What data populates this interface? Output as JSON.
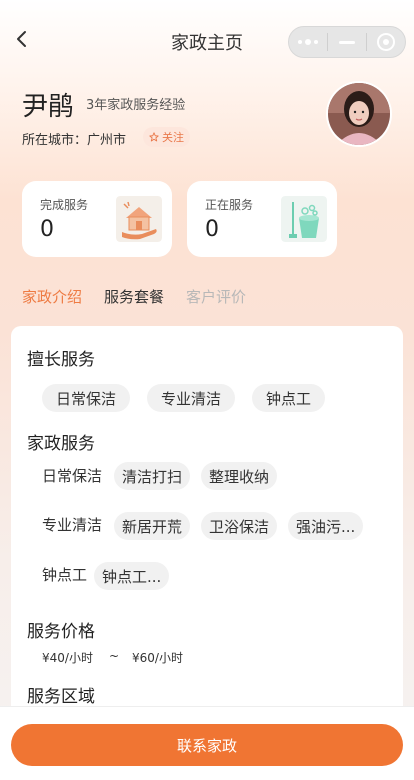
{
  "nav": {
    "title": "家政主页"
  },
  "profile": {
    "name": "尹鹃",
    "experience": "3年家政服务经验",
    "city": "所在城市：广州市",
    "follow_label": "关注"
  },
  "stats": [
    {
      "label": "完成服务",
      "value": "0"
    },
    {
      "label": "正在服务",
      "value": "0"
    }
  ],
  "tabs": [
    {
      "label": "家政介绍",
      "state": "active"
    },
    {
      "label": "服务套餐",
      "state": "normal"
    },
    {
      "label": "客户评价",
      "state": "muted"
    }
  ],
  "content": {
    "specialty_title": "擅长服务",
    "specialties": [
      "日常保洁",
      "专业清洁",
      "钟点工"
    ],
    "services_title": "家政服务",
    "service_groups": [
      {
        "label": "日常保洁",
        "items": [
          "清洁打扫",
          "整理收纳"
        ]
      },
      {
        "label": "专业清洁",
        "items": [
          "新居开荒",
          "卫浴保洁",
          "强油污..."
        ]
      },
      {
        "label": "钟点工",
        "items": [
          "钟点工..."
        ]
      }
    ],
    "price_title": "服务价格",
    "price_min": "¥40/小时",
    "price_sep": "~",
    "price_max": "¥60/小时",
    "area_title": "服务区域"
  },
  "footer": {
    "contact_label": "联系家政"
  },
  "colors": {
    "accent": "#f07533",
    "tab_active": "#ee7b43",
    "chip_bg": "#f1f1f1"
  }
}
